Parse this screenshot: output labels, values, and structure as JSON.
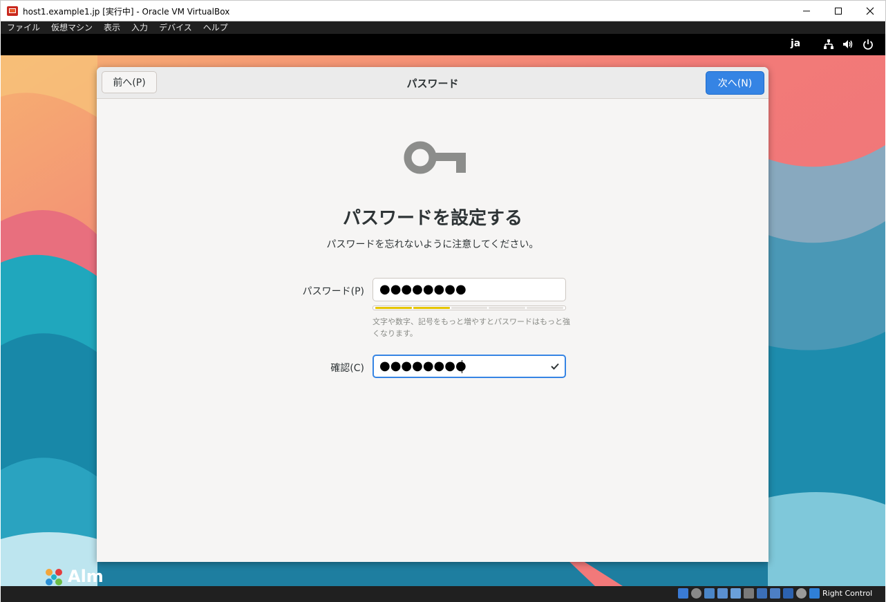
{
  "window": {
    "title": "host1.example1.jp [実行中] - Oracle VM VirtualBox",
    "menu": [
      "ファイル",
      "仮想マシン",
      "表示",
      "入力",
      "デバイス",
      "ヘルプ"
    ]
  },
  "topbar": {
    "language": "ja"
  },
  "desktop": {
    "logo_text": "Alm"
  },
  "dialog": {
    "title": "パスワード",
    "prev_label": "前へ(P)",
    "next_label": "次へ(N)",
    "heading": "パスワードを設定する",
    "subheading": "パスワードを忘れないように注意してください。",
    "password_label": "パスワード(P)",
    "password_value": "●●●●●●●●",
    "strength_level": 0.4,
    "hint": "文字や数字、記号をもっと増やすとパスワードはもっと強くなります。",
    "confirm_label": "確認(C)",
    "confirm_value": "●●●●●●●●"
  },
  "statusbar": {
    "host_key": "Right Control"
  },
  "colors": {
    "accent": "#3584e4",
    "strength": "#e5c400"
  }
}
